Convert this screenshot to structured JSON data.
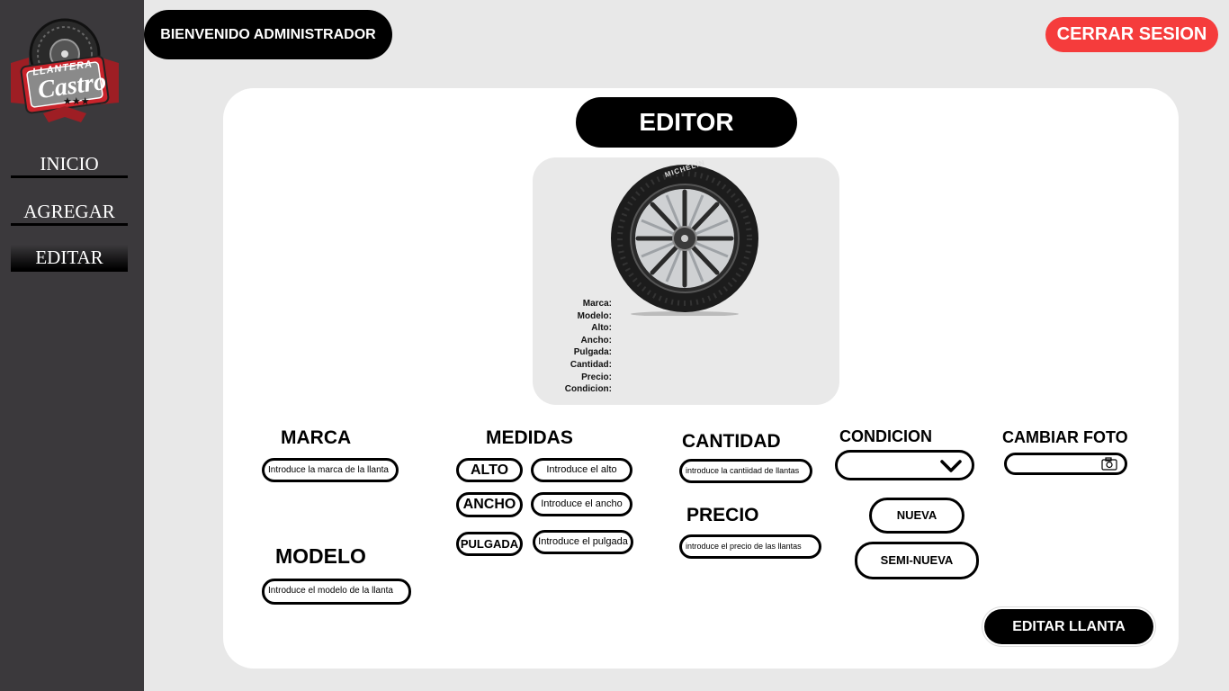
{
  "sidebar": {
    "logo": {
      "top_text": "LLANTERA",
      "script_text": "Castro",
      "stars": "★★★"
    },
    "items": [
      {
        "label": "INICIO"
      },
      {
        "label": "AGREGAR"
      },
      {
        "label": "EDITAR"
      }
    ]
  },
  "header": {
    "welcome": "BIENVENIDO ADMINISTRADOR",
    "logout": "CERRAR SESION"
  },
  "editor": {
    "title": "EDITOR",
    "preview": {
      "tire_brand": "MICHELIN",
      "specs": [
        "Marca:",
        "Modelo:",
        "Alto:",
        "Ancho:",
        "Pulgada:",
        "Cantidad:",
        "Precio:",
        "Condicion:"
      ]
    },
    "marca": {
      "label": "MARCA",
      "placeholder": "Introduce la marca de la llanta"
    },
    "modelo": {
      "label": "MODELO",
      "placeholder": "Introduce el modelo de la llanta"
    },
    "medidas": {
      "label": "MEDIDAS",
      "alto": {
        "label": "ALTO",
        "placeholder": "Introduce el alto"
      },
      "ancho": {
        "label": "ANCHO",
        "placeholder": "Introduce el ancho"
      },
      "pulgada": {
        "label": "PULGADA",
        "placeholder": "Introduce el pulgada"
      }
    },
    "cantidad": {
      "label": "CANTIDAD",
      "placeholder": "introduce la cantiidad de llantas"
    },
    "precio": {
      "label": "PRECIO",
      "placeholder": "introduce el precio de las llantas"
    },
    "condicion": {
      "label": "CONDICION",
      "selected": "",
      "options": [
        "NUEVA",
        "SEMI-NUEVA"
      ]
    },
    "foto": {
      "label": "CAMBIAR FOTO",
      "value": ""
    },
    "submit": "EDITAR LLANTA"
  },
  "colors": {
    "sidebar": "#3b393c",
    "accent": "#f53c3c",
    "background": "#e8e8e8"
  }
}
